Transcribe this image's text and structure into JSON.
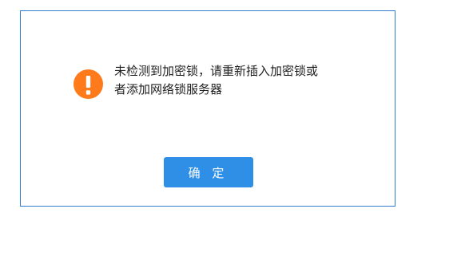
{
  "dialog": {
    "icon": "warning-circle-icon",
    "message_lines": [
      "未检测到加密锁，请重新插入加密锁或",
      "者添加网络锁服务器"
    ],
    "confirm_label": "确 定"
  },
  "colors": {
    "dialog_border": "#2f7fd1",
    "warning_icon": "#ff7a1a",
    "button": "#2f8fe6",
    "text": "#222222"
  }
}
